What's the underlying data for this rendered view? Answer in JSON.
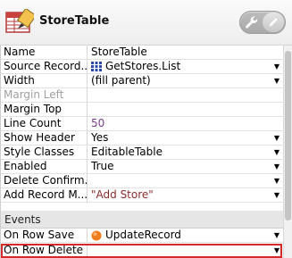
{
  "header": {
    "title": "StoreTable",
    "icon": "table-widget-icon",
    "tools": [
      "wrench-icon",
      "pencil-icon"
    ]
  },
  "properties": [
    {
      "name": "Name",
      "value": "StoreTable",
      "dropdown": false
    },
    {
      "name": "Source Record...",
      "value": "GetStores.List",
      "icon": "record-list-icon",
      "dropdown": true
    },
    {
      "name": "Width",
      "value": "(fill parent)",
      "dropdown": true
    },
    {
      "name": "Margin Left",
      "value": "",
      "dropdown": false,
      "disabled": true
    },
    {
      "name": "Margin Top",
      "value": "",
      "dropdown": false
    },
    {
      "name": "Line Count",
      "value": "50",
      "dropdown": false,
      "style": "number"
    },
    {
      "name": "Show Header",
      "value": "Yes",
      "dropdown": true
    },
    {
      "name": "Style Classes",
      "value": "EditableTable",
      "dropdown": true
    },
    {
      "name": "Enabled",
      "value": "True",
      "dropdown": true
    },
    {
      "name": "Delete Confirm...",
      "value": "",
      "dropdown": true
    },
    {
      "name": "Add Record M...",
      "value": "\"Add Store\"",
      "dropdown": true,
      "style": "string"
    }
  ],
  "events_section": "Events",
  "events": [
    {
      "name": "On Row Save",
      "value": "UpdateRecord",
      "icon": "action-circle-icon",
      "dropdown": true
    },
    {
      "name": "On Row Delete",
      "value": "",
      "dropdown": true,
      "highlighted": true
    }
  ],
  "dropdown_glyph": "▼",
  "colors": {
    "number": "#7a3c8a",
    "string": "#8b2d2d",
    "highlight": "#d42a2a",
    "action_icon": "#f07c1a",
    "record_icon": "#2b4aa8"
  }
}
